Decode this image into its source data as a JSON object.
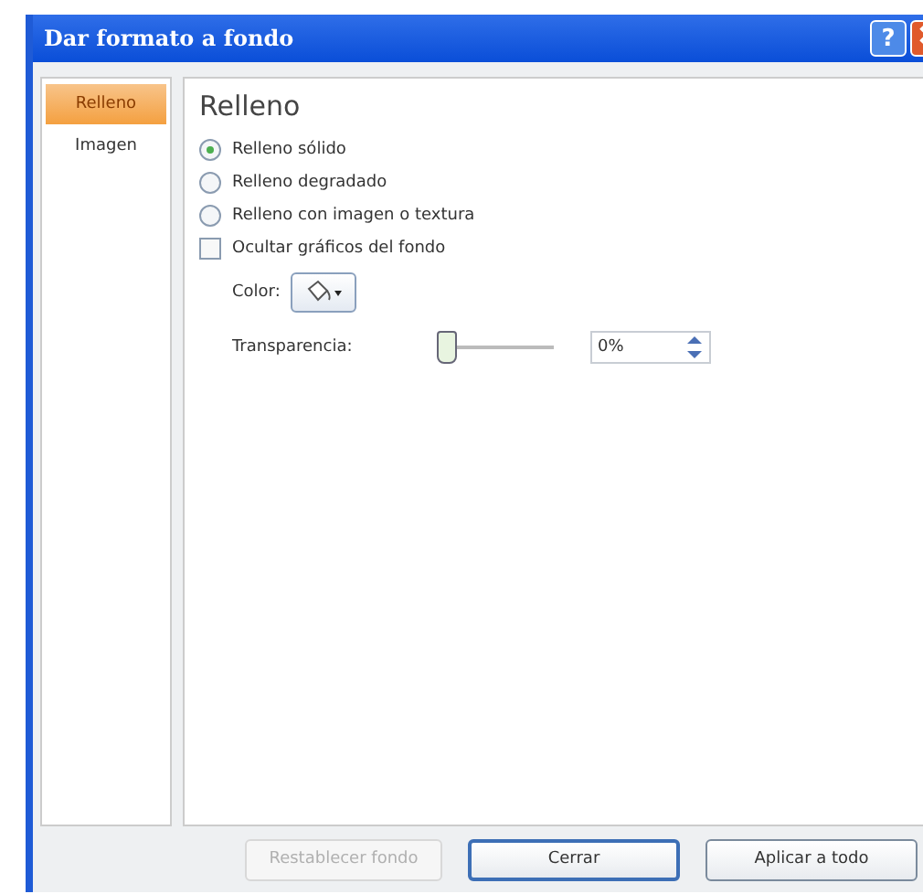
{
  "window": {
    "title": "Dar formato a fondo",
    "help": "?"
  },
  "sidebar": {
    "items": [
      {
        "label": "Relleno",
        "selected": true
      },
      {
        "label": "Imagen",
        "selected": false
      }
    ]
  },
  "section": {
    "title": "Relleno"
  },
  "options": [
    {
      "kind": "radio",
      "label": "Relleno sólido",
      "checked": true
    },
    {
      "kind": "radio",
      "label": "Relleno degradado",
      "checked": false
    },
    {
      "kind": "radio",
      "label": "Relleno con imagen o textura",
      "checked": false
    },
    {
      "kind": "checkbox",
      "label": "Ocultar gráficos del fondo",
      "checked": false
    }
  ],
  "color": {
    "label": "Color:"
  },
  "transparency": {
    "label": "Transparencia:",
    "level": 0,
    "value": "0%"
  },
  "buttons": [
    {
      "label": "Restablecer fondo",
      "disabled": true,
      "default": false
    },
    {
      "label": "Cerrar",
      "disabled": false,
      "default": true
    },
    {
      "label": "Aplicar a todo",
      "disabled": false,
      "default": false
    }
  ]
}
